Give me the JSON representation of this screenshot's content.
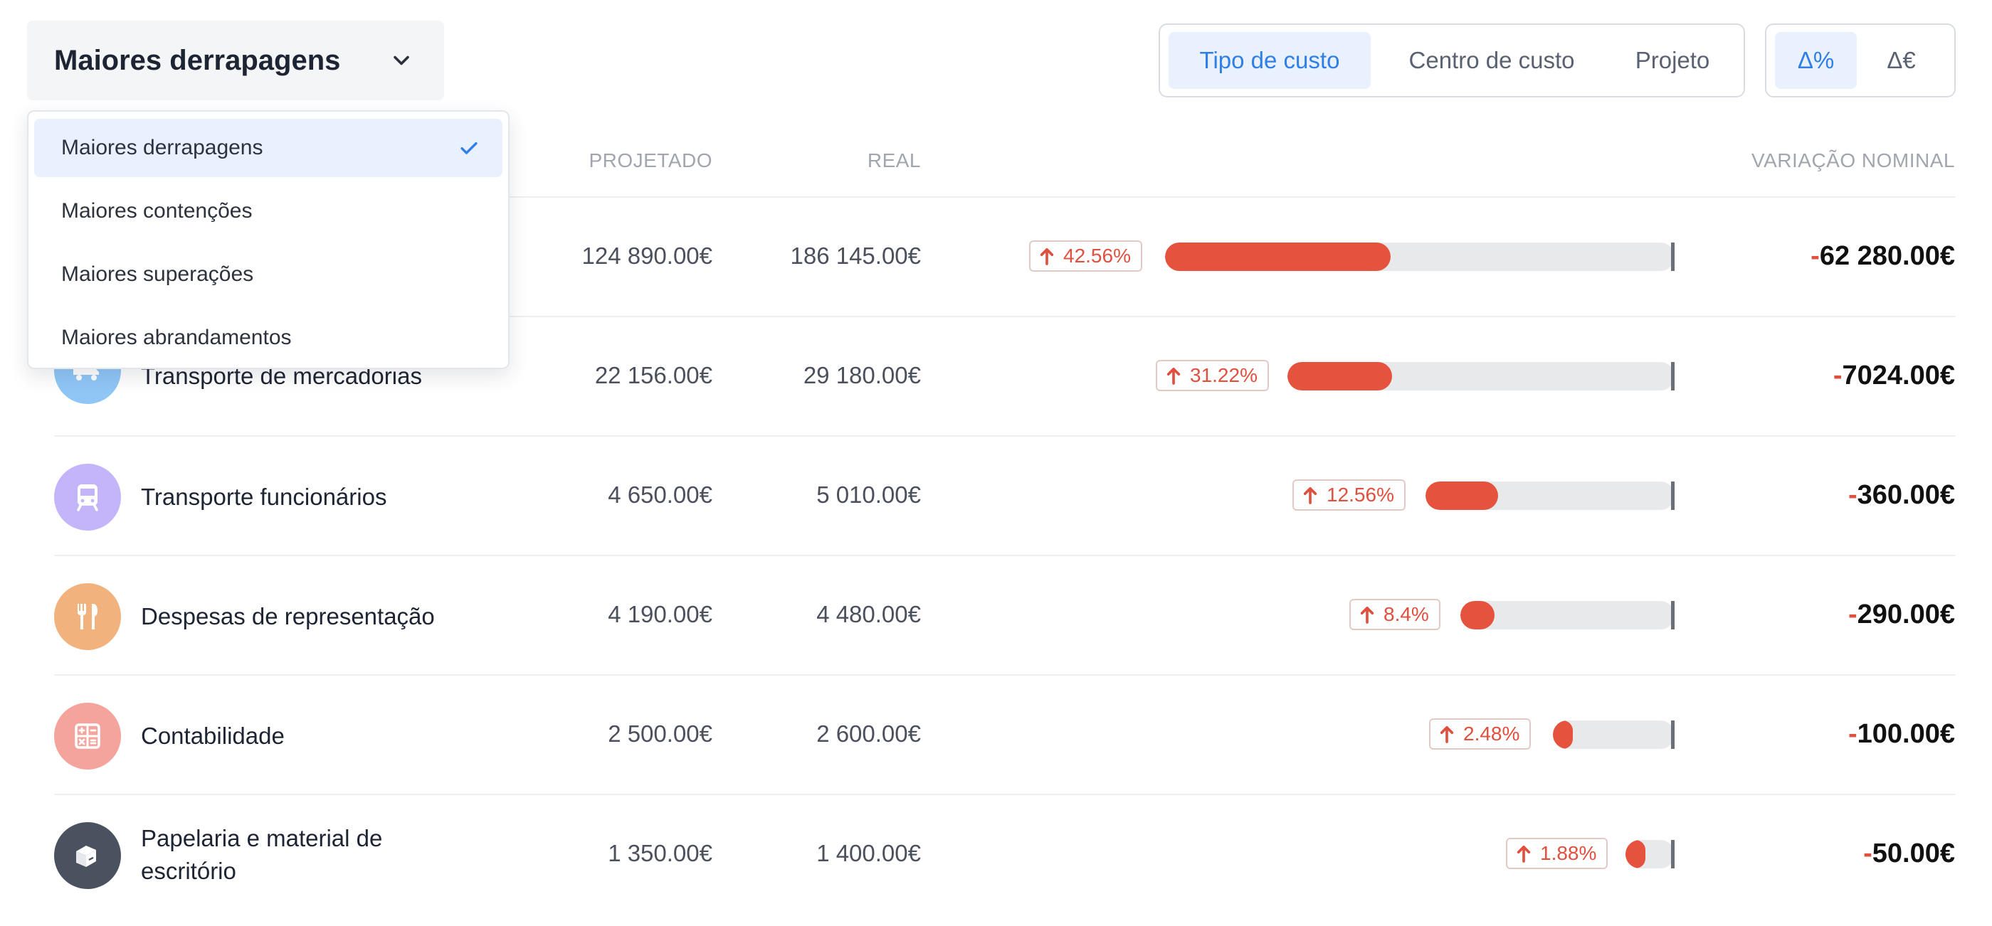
{
  "sort": {
    "selected": "Maiores derrapagens",
    "options": [
      {
        "label": "Maiores derrapagens",
        "selected": true
      },
      {
        "label": "Maiores contenções",
        "selected": false
      },
      {
        "label": "Maiores superações",
        "selected": false
      },
      {
        "label": "Maiores abrandamentos",
        "selected": false
      }
    ]
  },
  "grouping": {
    "tabs": [
      {
        "label": "Tipo de custo",
        "active": true
      },
      {
        "label": "Centro de custo",
        "active": false
      },
      {
        "label": "Projeto",
        "active": false
      }
    ]
  },
  "unit_toggle": {
    "options": [
      {
        "label": "Δ%",
        "active": true
      },
      {
        "label": "Δ€",
        "active": false
      }
    ]
  },
  "table": {
    "headers": {
      "projected": "PROJETADO",
      "real": "REAL",
      "nominal": "VARIAÇÃO NOMINAL"
    },
    "rows": [
      {
        "name": "",
        "projected": "124 890.00€",
        "real": "186 145.00€",
        "pct": "42.56%",
        "pct_value": 42.56,
        "nominal_sign": "-",
        "nominal": "62 280.00€",
        "icon": "hidden-icon",
        "color": "#f0a58c"
      },
      {
        "name": "Transporte de mercadorias",
        "projected": "22 156.00€",
        "real": "29 180.00€",
        "pct": "31.22%",
        "pct_value": 31.22,
        "nominal_sign": "-",
        "nominal": "7024.00€",
        "icon": "truck-icon",
        "color": "#8fc6f6"
      },
      {
        "name": "Transporte funcionários",
        "projected": "4 650.00€",
        "real": "5 010.00€",
        "pct": "12.56%",
        "pct_value": 12.56,
        "nominal_sign": "-",
        "nominal": "360.00€",
        "icon": "bus-icon",
        "color": "#c4b5fb"
      },
      {
        "name": "Despesas de representação",
        "projected": "4 190.00€",
        "real": "4 480.00€",
        "pct": "8.4%",
        "pct_value": 8.4,
        "nominal_sign": "-",
        "nominal": "290.00€",
        "icon": "utensils-icon",
        "color": "#f1b27e"
      },
      {
        "name": "Contabilidade",
        "projected": "2 500.00€",
        "real": "2 600.00€",
        "pct": "2.48%",
        "pct_value": 2.48,
        "nominal_sign": "-",
        "nominal": "100.00€",
        "icon": "calculator-icon",
        "color": "#f5a39d"
      },
      {
        "name": "Papelaria e material de escritório",
        "projected": "1 350.00€",
        "real": "1 400.00€",
        "pct": "1.88%",
        "pct_value": 1.88,
        "nominal_sign": "-",
        "nominal": "50.00€",
        "icon": "stationery-icon",
        "color": "#4a5260"
      }
    ]
  },
  "colors": {
    "accent": "#2f7fe6",
    "overrun": "#e5533f",
    "track": "#e8e9eb"
  }
}
